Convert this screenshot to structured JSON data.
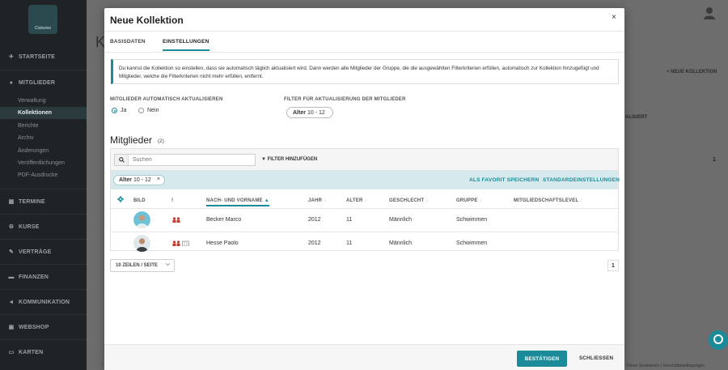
{
  "sidebar": {
    "logo_text": "Clubwise",
    "sections": [
      {
        "label": "STARTSEITE",
        "icon": "rocket-icon"
      },
      {
        "label": "MITGLIEDER",
        "icon": "user-icon"
      },
      {
        "label": "TERMINE",
        "icon": "calendar-icon"
      },
      {
        "label": "KURSE",
        "icon": "course-icon"
      },
      {
        "label": "VERTRÄGE",
        "icon": "contract-icon"
      },
      {
        "label": "FINANZEN",
        "icon": "money-icon"
      },
      {
        "label": "KOMMUNIKATION",
        "icon": "megaphone-icon"
      },
      {
        "label": "WEBSHOP",
        "icon": "shop-icon"
      },
      {
        "label": "KARTEN",
        "icon": "card-icon"
      }
    ],
    "members_sub": [
      "Verwaltung",
      "Kollektionen",
      "Berichte",
      "Archiv",
      "Änderungen",
      "Veröffentlichungen",
      "PDF-Ausdrucke"
    ]
  },
  "background": {
    "page_title_initial": "K",
    "new_collection_label": "NEUE KOLLEKTION",
    "right_label": "ALISIERT",
    "page_number": "1",
    "footer_text": "Demo Sportverein  |  Geschäftsbedingungen"
  },
  "modal": {
    "title": "Neue Kollektion",
    "close_symbol": "×",
    "tabs": [
      {
        "label": "BASISDATEN",
        "active": false
      },
      {
        "label": "EINSTELLUNGEN",
        "active": true
      }
    ],
    "info_text": "Du kannst die Kollektion so einstellen, dass sie automatisch täglich aktualisiert wird. Dann werden alle Mitglieder der Gruppe, die die ausgewählten Filterkriterien erfüllen, automatisch zur Kollektion hinzugefügt und Mitglieder, welche die Filterkriterien nicht mehr erfüllen, entfernt.",
    "auto_update": {
      "label": "MITGLIEDER AUTOMATISCH AKTUALISIEREN",
      "options": [
        {
          "label": "Ja",
          "selected": true
        },
        {
          "label": "Nein",
          "selected": false
        }
      ]
    },
    "update_filter": {
      "label": "FILTER FÜR AKTUALISIERUNG DER MITGLIEDER",
      "filter_key": "Alter",
      "filter_value": "10 - 12"
    },
    "members": {
      "title": "Mitglieder",
      "count": "(2)",
      "search_placeholder": "Suchen",
      "add_filter_label": "FILTER HINZUFÜGEN",
      "active_chip_key": "Alter",
      "active_chip_value": "10 - 12",
      "chip_remove": "×",
      "save_favorite_label": "ALS FAVORIT SPEICHERN",
      "default_settings_label": "STANDARDEINSTELLUNGEN",
      "columns": [
        "BILD",
        "!",
        "NACH- UND VORNAME",
        "JAHR",
        "ALTER",
        "GESCHLECHT",
        "GRUPPE",
        "MITGLIEDSCHAFTSLEVEL"
      ],
      "rows": [
        {
          "name": "Becker Marco",
          "year": "2012",
          "age": "11",
          "gender": "Männlich",
          "group": "Schwimmen",
          "level": ""
        },
        {
          "name": "Hesse Paolo",
          "year": "2012",
          "age": "11",
          "gender": "Männlich",
          "group": "Schwimmen",
          "level": ""
        }
      ],
      "page_size_label": "10 ZEILEN / SEITE",
      "page_number": "1"
    },
    "confirm_label": "BESTÄTIGEN",
    "close_label": "SCHLIESSEN"
  },
  "colors": {
    "accent": "#1b8a99",
    "filter_bar": "#d6eaed",
    "sidebar_bg": "#1f2326"
  }
}
